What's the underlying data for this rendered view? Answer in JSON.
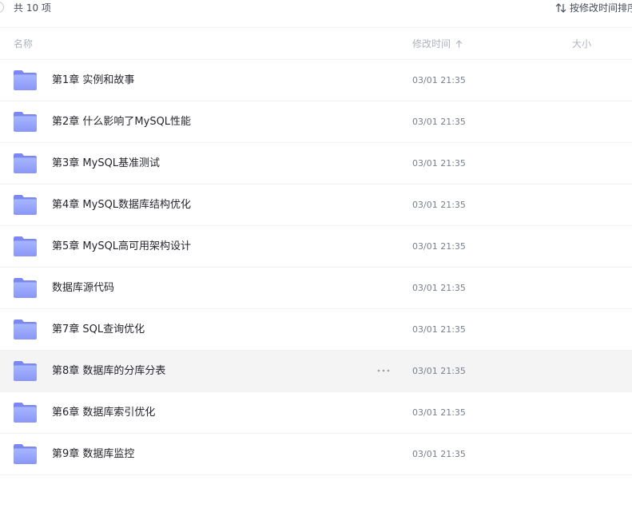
{
  "toolbar": {
    "count_label": "共 10 项",
    "sort_label": "按修改时间排序"
  },
  "table_header": {
    "name": "名称",
    "modified": "修改时间",
    "size": "大小"
  },
  "files": [
    {
      "name": "第1章 实例和故事",
      "modified": "03/01 21:35"
    },
    {
      "name": "第2章 什么影响了MySQL性能",
      "modified": "03/01 21:35"
    },
    {
      "name": "第3章 MySQL基准测试",
      "modified": "03/01 21:35"
    },
    {
      "name": "第4章 MySQL数据库结构优化",
      "modified": "03/01 21:35"
    },
    {
      "name": "第5章 MySQL高可用架构设计",
      "modified": "03/01 21:35"
    },
    {
      "name": "数据库源代码",
      "modified": "03/01 21:35"
    },
    {
      "name": "第7章 SQL查询优化",
      "modified": "03/01 21:35"
    },
    {
      "name": "第8章 数据库的分库分表",
      "modified": "03/01 21:35"
    },
    {
      "name": "第6章 数据库索引优化",
      "modified": "03/01 21:35"
    },
    {
      "name": "第9章 数据库监控",
      "modified": "03/01 21:35"
    }
  ],
  "icons": {
    "folder": "folder-icon",
    "more": "more-icon",
    "sort": "sort-icon",
    "sort_direction": "arrow-up-icon"
  },
  "colors": {
    "folder_front_top": "#a7b6ff",
    "folder_front_bottom": "#8a96f6",
    "folder_back": "#7c88f2",
    "hover_row": "#f4f4f5"
  }
}
